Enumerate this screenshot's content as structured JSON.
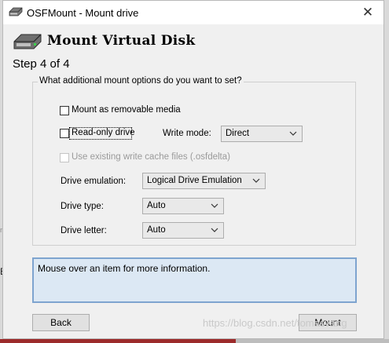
{
  "window": {
    "title": "OSFMount - Mount drive",
    "close_label": "✕"
  },
  "header": {
    "title": "Mount Virtual Disk",
    "step": "Step 4 of 4"
  },
  "options": {
    "group_label": "What additional mount options do you want to set?",
    "removable_label": "Mount as removable media",
    "readonly_label": "Read-only drive",
    "write_mode_label": "Write mode:",
    "write_mode_value": "Direct",
    "cache_label": "Use existing write cache files (.osfdelta)",
    "emulation_label": "Drive emulation:",
    "emulation_value": "Logical Drive Emulation",
    "type_label": "Drive type:",
    "type_value": "Auto",
    "letter_label": "Drive letter:",
    "letter_value": "Auto"
  },
  "info": {
    "text": "Mouse over an item for more information."
  },
  "buttons": {
    "back": "Back",
    "mount": "Mount"
  },
  "background": {
    "watermark": "https://blog.csdn.net/tomasvang"
  },
  "icons": {
    "app": "disk-drive-icon",
    "chevron": "chevron-down-icon"
  }
}
